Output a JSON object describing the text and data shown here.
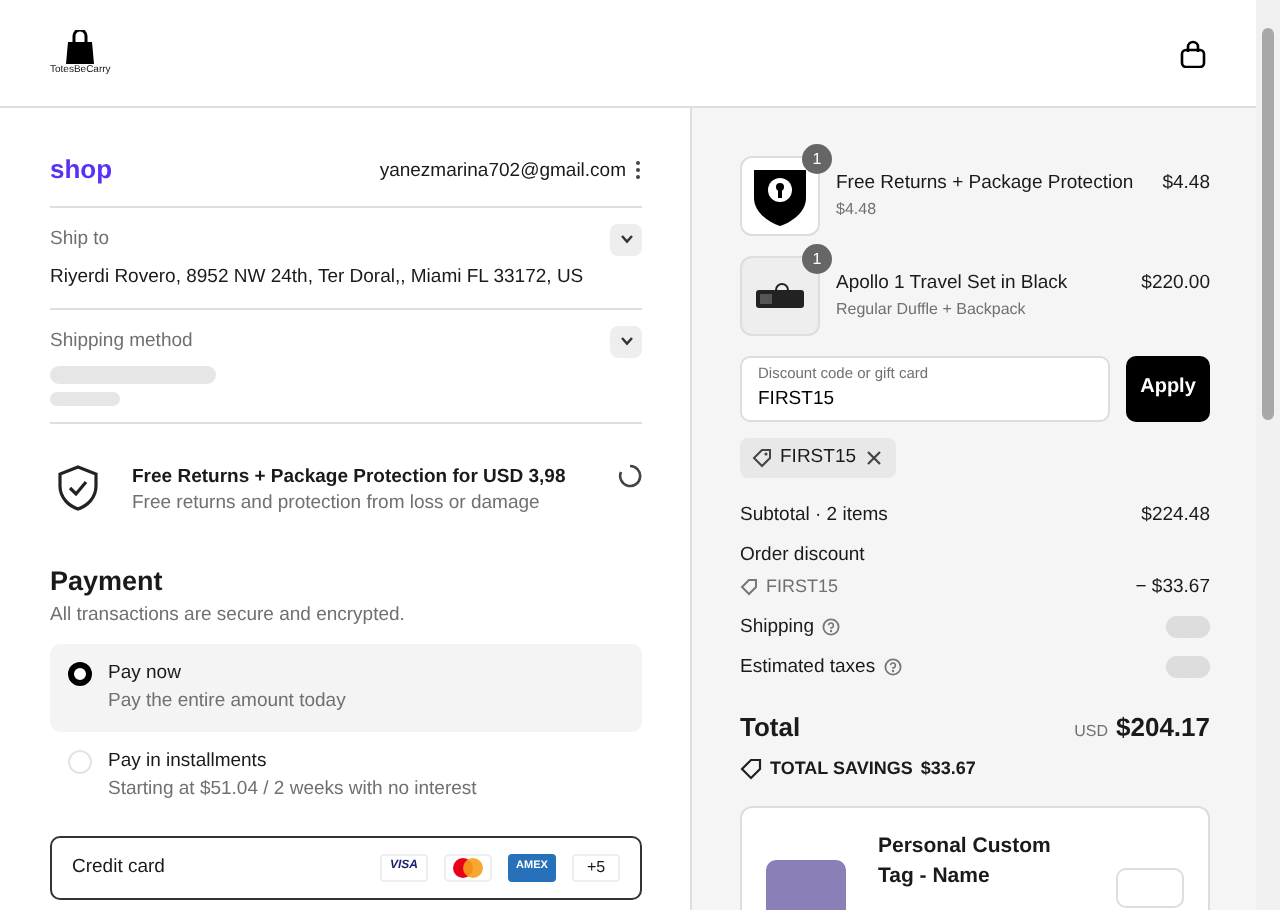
{
  "header": {
    "logo_text": "TotesBeCarry"
  },
  "contact": {
    "brand": "shop",
    "email": "yanezmarina702@gmail.com"
  },
  "sections": [
    {
      "label": "Ship to",
      "value": "Riyerdi Rovero, 8952 NW 24th, Ter Doral,, Miami FL 33172, US",
      "loading": false
    },
    {
      "label": "Shipping method",
      "loading": true
    }
  ],
  "protection_offer": {
    "title": "Free Returns + Package Protection for USD 3,98",
    "subtitle": "Free returns and protection from loss or damage",
    "loading": true
  },
  "payment": {
    "title": "Payment",
    "subtitle": "All transactions are secure and encrypted.",
    "options": [
      {
        "label": "Pay now",
        "detail": "Pay the entire amount today",
        "selected": true
      },
      {
        "label": "Pay in installments",
        "detail": "Starting at $51.04 / 2 weeks with no interest",
        "selected": false
      }
    ],
    "method": {
      "label": "Credit card",
      "brands": [
        {
          "kind": "visa",
          "text": "VISA"
        },
        {
          "kind": "mastercard"
        },
        {
          "kind": "amex",
          "text": "AMEX"
        }
      ],
      "more": "+5"
    }
  },
  "items": [
    {
      "kind": "shield",
      "name": "Free Returns + Package Protection",
      "detail": "$4.48",
      "price": "$4.48",
      "quantity": "1"
    },
    {
      "kind": "bag",
      "name": "Apollo 1 Travel Set in Black",
      "detail": "Regular Duffle + Backpack",
      "price": "$220.00",
      "quantity": "1"
    }
  ],
  "discount": {
    "placeholder": "Discount code or gift card",
    "value": "FIRST15",
    "button": "Apply",
    "applied": "FIRST15"
  },
  "summary": [
    {
      "kind": "value",
      "label": "Subtotal · 2 items",
      "value": "$224.48"
    },
    {
      "kind": "heading",
      "label": "Order discount"
    },
    {
      "kind": "code",
      "label": "FIRST15",
      "value": "− $33.67"
    },
    {
      "kind": "loading",
      "label": "Shipping"
    },
    {
      "kind": "loading",
      "label": "Estimated taxes"
    }
  ],
  "total": {
    "label": "Total",
    "currency": "USD",
    "amount": "$204.17",
    "savings_label": "TOTAL SAVINGS",
    "savings": "$33.67"
  },
  "upsell": {
    "name": "Personal Custom Tag - Name"
  }
}
